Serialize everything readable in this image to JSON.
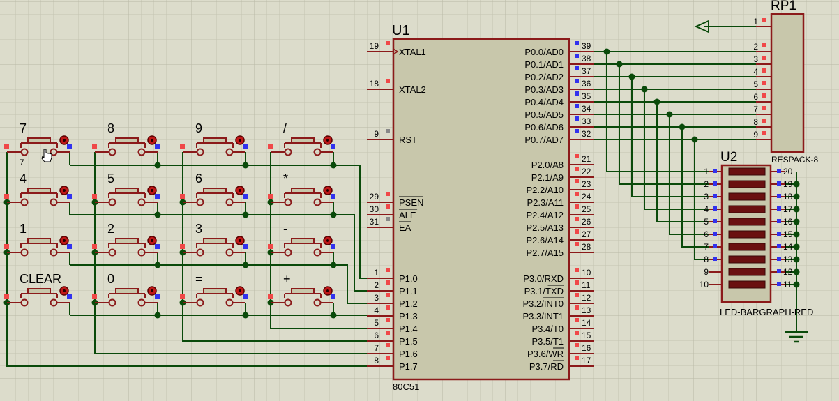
{
  "u1": {
    "ref": "U1",
    "part": "80C51",
    "left_pins": [
      {
        "num": "19",
        "name": "XTAL1"
      },
      {
        "num": "18",
        "name": "XTAL2"
      },
      {
        "num": "9",
        "name": "RST"
      },
      {
        "num": "29",
        "name": "PSEN"
      },
      {
        "num": "30",
        "name": "ALE"
      },
      {
        "num": "31",
        "name": "EA"
      },
      {
        "num": "1",
        "name": "P1.0"
      },
      {
        "num": "2",
        "name": "P1.1"
      },
      {
        "num": "3",
        "name": "P1.2"
      },
      {
        "num": "4",
        "name": "P1.3"
      },
      {
        "num": "5",
        "name": "P1.4"
      },
      {
        "num": "6",
        "name": "P1.5"
      },
      {
        "num": "7",
        "name": "P1.6"
      },
      {
        "num": "8",
        "name": "P1.7"
      }
    ],
    "right_pins": [
      {
        "num": "39",
        "name": "P0.0/AD0"
      },
      {
        "num": "38",
        "name": "P0.1/AD1"
      },
      {
        "num": "37",
        "name": "P0.2/AD2"
      },
      {
        "num": "36",
        "name": "P0.3/AD3"
      },
      {
        "num": "35",
        "name": "P0.4/AD4"
      },
      {
        "num": "34",
        "name": "P0.5/AD5"
      },
      {
        "num": "33",
        "name": "P0.6/AD6"
      },
      {
        "num": "32",
        "name": "P0.7/AD7"
      },
      {
        "num": "21",
        "name": "P2.0/A8"
      },
      {
        "num": "22",
        "name": "P2.1/A9"
      },
      {
        "num": "23",
        "name": "P2.2/A10"
      },
      {
        "num": "24",
        "name": "P2.3/A11"
      },
      {
        "num": "25",
        "name": "P2.4/A12"
      },
      {
        "num": "26",
        "name": "P2.5/A13"
      },
      {
        "num": "27",
        "name": "P2.6/A14"
      },
      {
        "num": "28",
        "name": "P2.7/A15"
      },
      {
        "num": "10",
        "name": "P3.0/RXD"
      },
      {
        "num": "11",
        "name": "P3.1/TXD"
      },
      {
        "num": "12",
        "name": "P3.2/INT0"
      },
      {
        "num": "13",
        "name": "P3.3/INT1"
      },
      {
        "num": "14",
        "name": "P3.4/T0"
      },
      {
        "num": "15",
        "name": "P3.5/T1"
      },
      {
        "num": "16",
        "name": "P3.6/WR"
      },
      {
        "num": "17",
        "name": "P3.7/RD"
      }
    ]
  },
  "rp1": {
    "ref": "RP1",
    "part": "RESPACK-8",
    "pins": [
      "1",
      "2",
      "3",
      "4",
      "5",
      "6",
      "7",
      "8",
      "9"
    ]
  },
  "u2": {
    "ref": "U2",
    "part": "LED-BARGRAPH-RED",
    "left_pins": [
      "1",
      "2",
      "3",
      "4",
      "5",
      "6",
      "7",
      "8",
      "9",
      "10"
    ],
    "right_pins": [
      "20",
      "19",
      "18",
      "17",
      "16",
      "15",
      "14",
      "13",
      "12",
      "11"
    ]
  },
  "keypad": {
    "keys": [
      [
        "7",
        "8",
        "9",
        "/"
      ],
      [
        "4",
        "5",
        "6",
        "*"
      ],
      [
        "1",
        "2",
        "3",
        "-"
      ],
      [
        "CLEAR",
        "0",
        "=",
        "+"
      ]
    ],
    "small_label": "7"
  },
  "colors": {
    "background": "#dcdccb",
    "grid": "#c4c4b2",
    "wire": "#0a4a0a",
    "component_outline": "#8b1a1a",
    "chip_fill": "#c8c7ab",
    "pin_red": "#f04848",
    "pin_blue": "#3232ee",
    "led_segment": "#6a1010"
  }
}
